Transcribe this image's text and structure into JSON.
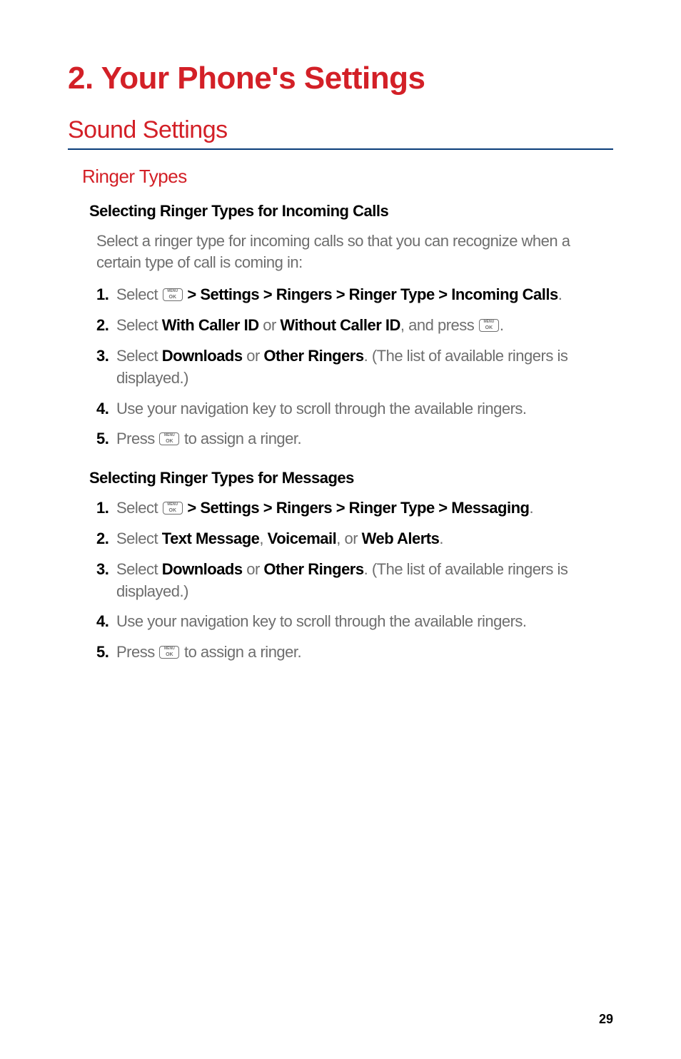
{
  "chapter": {
    "title": "2. Your Phone's Settings"
  },
  "section": {
    "title": "Sound Settings"
  },
  "subsection": {
    "title": "Ringer Types"
  },
  "topic1": {
    "title": "Selecting Ringer Types for Incoming Calls",
    "intro": "Select a ringer type for incoming calls so that you can recognize when a certain type of call is coming in:",
    "steps": {
      "s1": {
        "num": "1.",
        "pre": "Select ",
        "path": " > Settings > Ringers > Ringer Type > Incoming Calls",
        "post": "."
      },
      "s2": {
        "num": "2.",
        "pre": "Select ",
        "b1": "With Caller ID",
        "mid": " or ",
        "b2": "Without Caller ID",
        "aft": ", and press ",
        "post": "."
      },
      "s3": {
        "num": "3.",
        "pre": "Select ",
        "b1": "Downloads",
        "mid": " or ",
        "b2": "Other Ringers",
        "post": ". (The list of available ringers is displayed.)"
      },
      "s4": {
        "num": "4.",
        "text": "Use your navigation key to scroll through the available ringers."
      },
      "s5": {
        "num": "5.",
        "pre": "Press ",
        "post": " to assign a ringer."
      }
    }
  },
  "topic2": {
    "title": "Selecting Ringer Types for Messages",
    "steps": {
      "s1": {
        "num": "1.",
        "pre": "Select ",
        "path": " > Settings > Ringers > Ringer Type > Messaging",
        "post": "."
      },
      "s2": {
        "num": "2.",
        "pre": "Select ",
        "b1": "Text Message",
        "c1": ", ",
        "b2": "Voicemail",
        "c2": ", or ",
        "b3": "Web Alerts",
        "post": "."
      },
      "s3": {
        "num": "3.",
        "pre": "Select ",
        "b1": "Downloads",
        "mid": " or ",
        "b2": "Other Ringers",
        "post": ". (The list of available ringers is displayed.)"
      },
      "s4": {
        "num": "4.",
        "text": "Use your navigation key to scroll through the available ringers."
      },
      "s5": {
        "num": "5.",
        "pre": "Press ",
        "post": " to assign a ringer."
      }
    }
  },
  "pageNumber": "29"
}
